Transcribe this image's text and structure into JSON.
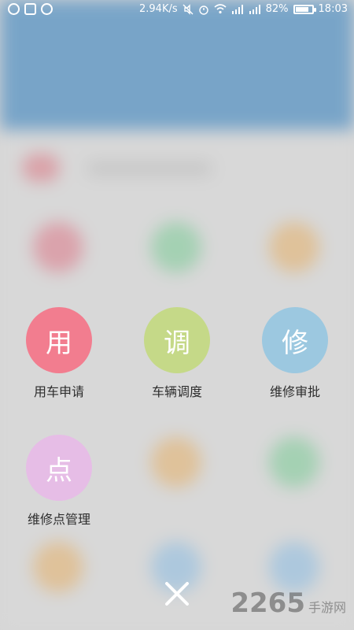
{
  "status_bar": {
    "speed": "2.94K/s",
    "battery": "82%",
    "battery_level": 0.82,
    "time": "18:03"
  },
  "menu": [
    {
      "glyph": "用",
      "label": "用车申请",
      "color": "#f27d8f"
    },
    {
      "glyph": "调",
      "label": "车辆调度",
      "color": "#c5d988"
    },
    {
      "glyph": "修",
      "label": "维修审批",
      "color": "#9cc8e0"
    },
    {
      "glyph": "点",
      "label": "维修点管理",
      "color": "#e6bde6"
    }
  ],
  "close_icon": "close-icon",
  "watermark": {
    "number": "2265",
    "text": "手游网"
  }
}
